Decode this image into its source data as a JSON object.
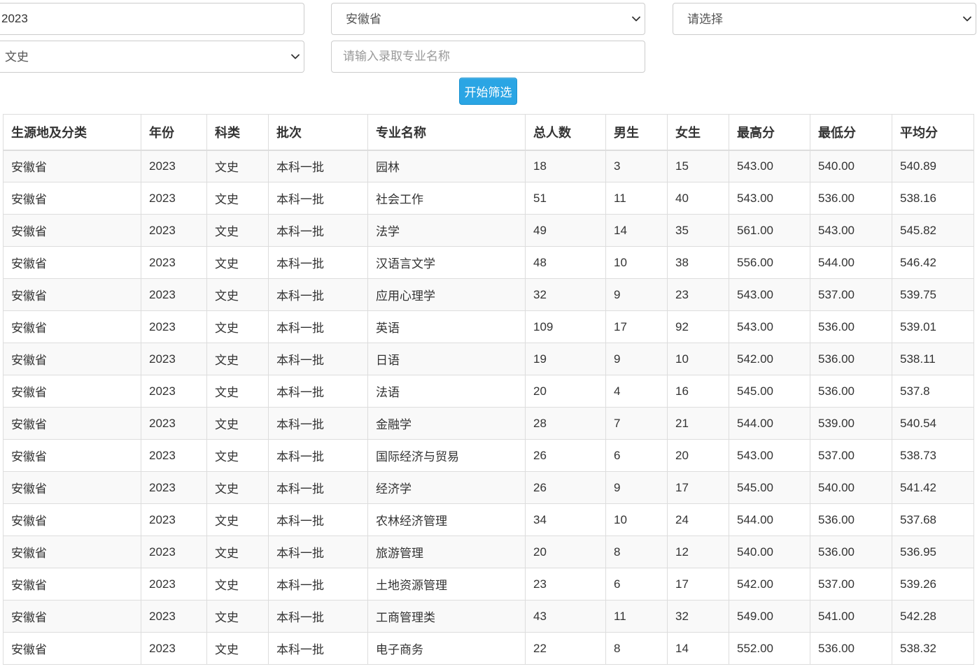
{
  "filters": {
    "year": {
      "value": "2023"
    },
    "province": {
      "selected": "安徽省"
    },
    "third_select": {
      "selected": "请选择"
    },
    "subject": {
      "selected": "文史"
    },
    "major": {
      "placeholder": "请输入录取专业名称"
    }
  },
  "filter_button_label": "开始筛选",
  "icons": {
    "dropdown": "chevron-down-icon"
  },
  "colors": {
    "accent": "#2aa5e4",
    "accent_border": "#1b93d1",
    "border": "#dddddd",
    "input_border": "#cccccc",
    "stripe": "#f9f9f9",
    "text": "#333333",
    "input_text": "#555555",
    "placeholder": "#999999"
  },
  "table": {
    "columns": [
      "生源地及分类",
      "年份",
      "科类",
      "批次",
      "专业名称",
      "总人数",
      "男生",
      "女生",
      "最高分",
      "最低分",
      "平均分"
    ],
    "rows": [
      [
        "安徽省",
        "2023",
        "文史",
        "本科一批",
        "园林",
        "18",
        "3",
        "15",
        "543.00",
        "540.00",
        "540.89"
      ],
      [
        "安徽省",
        "2023",
        "文史",
        "本科一批",
        "社会工作",
        "51",
        "11",
        "40",
        "543.00",
        "536.00",
        "538.16"
      ],
      [
        "安徽省",
        "2023",
        "文史",
        "本科一批",
        "法学",
        "49",
        "14",
        "35",
        "561.00",
        "543.00",
        "545.82"
      ],
      [
        "安徽省",
        "2023",
        "文史",
        "本科一批",
        "汉语言文学",
        "48",
        "10",
        "38",
        "556.00",
        "544.00",
        "546.42"
      ],
      [
        "安徽省",
        "2023",
        "文史",
        "本科一批",
        "应用心理学",
        "32",
        "9",
        "23",
        "543.00",
        "537.00",
        "539.75"
      ],
      [
        "安徽省",
        "2023",
        "文史",
        "本科一批",
        "英语",
        "109",
        "17",
        "92",
        "543.00",
        "536.00",
        "539.01"
      ],
      [
        "安徽省",
        "2023",
        "文史",
        "本科一批",
        "日语",
        "19",
        "9",
        "10",
        "542.00",
        "536.00",
        "538.11"
      ],
      [
        "安徽省",
        "2023",
        "文史",
        "本科一批",
        "法语",
        "20",
        "4",
        "16",
        "545.00",
        "536.00",
        "537.8"
      ],
      [
        "安徽省",
        "2023",
        "文史",
        "本科一批",
        "金融学",
        "28",
        "7",
        "21",
        "544.00",
        "539.00",
        "540.54"
      ],
      [
        "安徽省",
        "2023",
        "文史",
        "本科一批",
        "国际经济与贸易",
        "26",
        "6",
        "20",
        "543.00",
        "537.00",
        "538.73"
      ],
      [
        "安徽省",
        "2023",
        "文史",
        "本科一批",
        "经济学",
        "26",
        "9",
        "17",
        "545.00",
        "540.00",
        "541.42"
      ],
      [
        "安徽省",
        "2023",
        "文史",
        "本科一批",
        "农林经济管理",
        "34",
        "10",
        "24",
        "544.00",
        "536.00",
        "537.68"
      ],
      [
        "安徽省",
        "2023",
        "文史",
        "本科一批",
        "旅游管理",
        "20",
        "8",
        "12",
        "540.00",
        "536.00",
        "536.95"
      ],
      [
        "安徽省",
        "2023",
        "文史",
        "本科一批",
        "土地资源管理",
        "23",
        "6",
        "17",
        "542.00",
        "537.00",
        "539.26"
      ],
      [
        "安徽省",
        "2023",
        "文史",
        "本科一批",
        "工商管理类",
        "43",
        "11",
        "32",
        "549.00",
        "541.00",
        "542.28"
      ],
      [
        "安徽省",
        "2023",
        "文史",
        "本科一批",
        "电子商务",
        "22",
        "8",
        "14",
        "552.00",
        "536.00",
        "538.32"
      ]
    ]
  }
}
